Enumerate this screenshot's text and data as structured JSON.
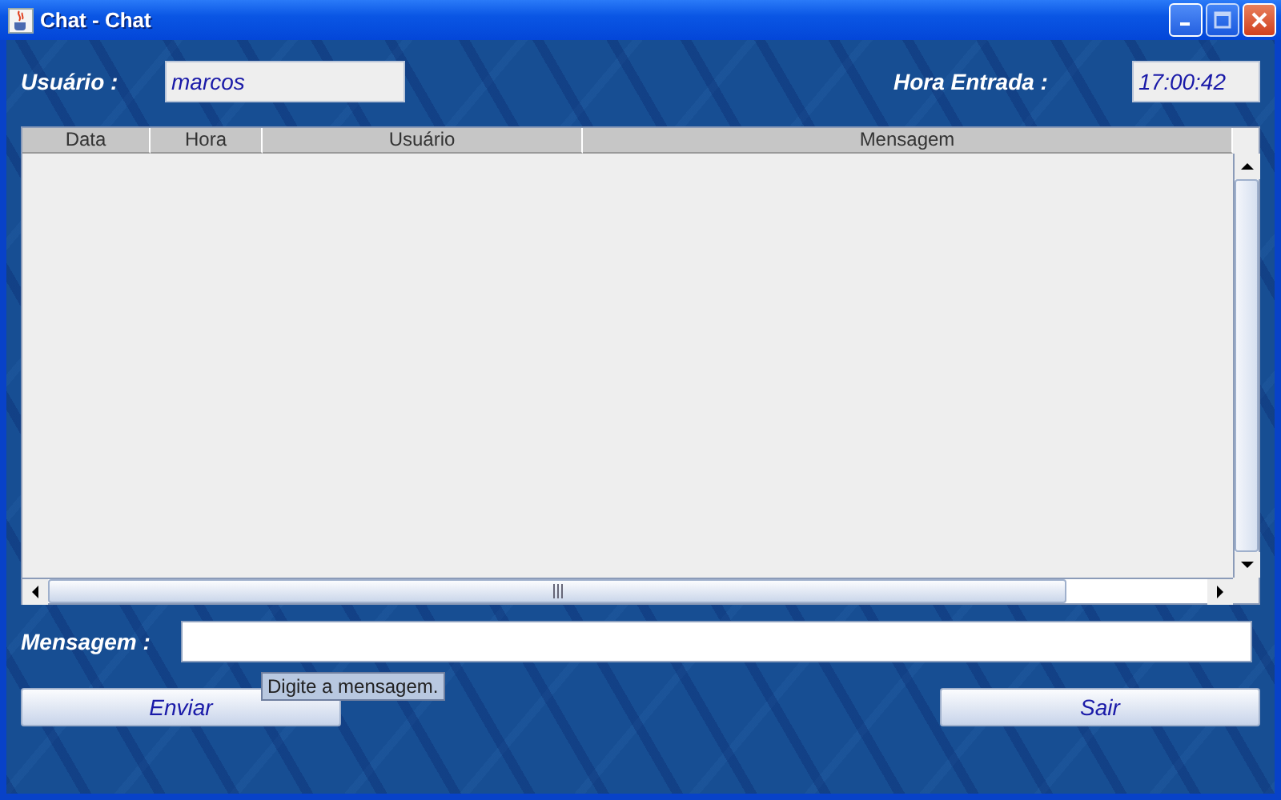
{
  "window": {
    "title": "Chat - Chat"
  },
  "user": {
    "label": "Usuário :",
    "value": "marcos"
  },
  "entry_time": {
    "label": "Hora Entrada :",
    "value": "17:00:42"
  },
  "table": {
    "columns": [
      "Data",
      "Hora",
      "Usuário",
      "Mensagem"
    ]
  },
  "message": {
    "label": "Mensagem :",
    "tooltip": "Digite a mensagem."
  },
  "buttons": [
    {
      "label": "Enviar"
    },
    {
      "label": "Sair"
    }
  ]
}
